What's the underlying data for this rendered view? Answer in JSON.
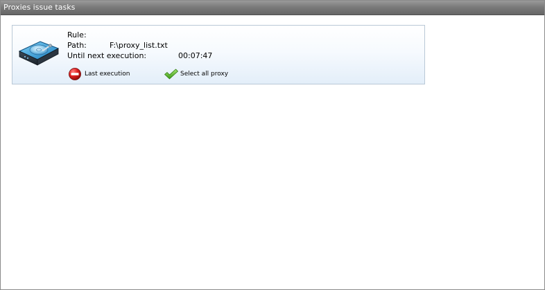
{
  "window": {
    "title": "Proxies issue tasks"
  },
  "task": {
    "icon": "hard-drive-icon",
    "rule_label": "Rule:",
    "rule_value": "",
    "path_label": "Path:",
    "path_value": "F:\\proxy_list.txt",
    "next_label": "Until next execution:",
    "next_value": "00:07:47",
    "actions": [
      {
        "label": "Last execution",
        "icon": "stop-icon",
        "color": "#cc1a1a"
      },
      {
        "label": "Select all proxy",
        "icon": "checkmark-icon",
        "color": "#5cb82a"
      }
    ]
  }
}
